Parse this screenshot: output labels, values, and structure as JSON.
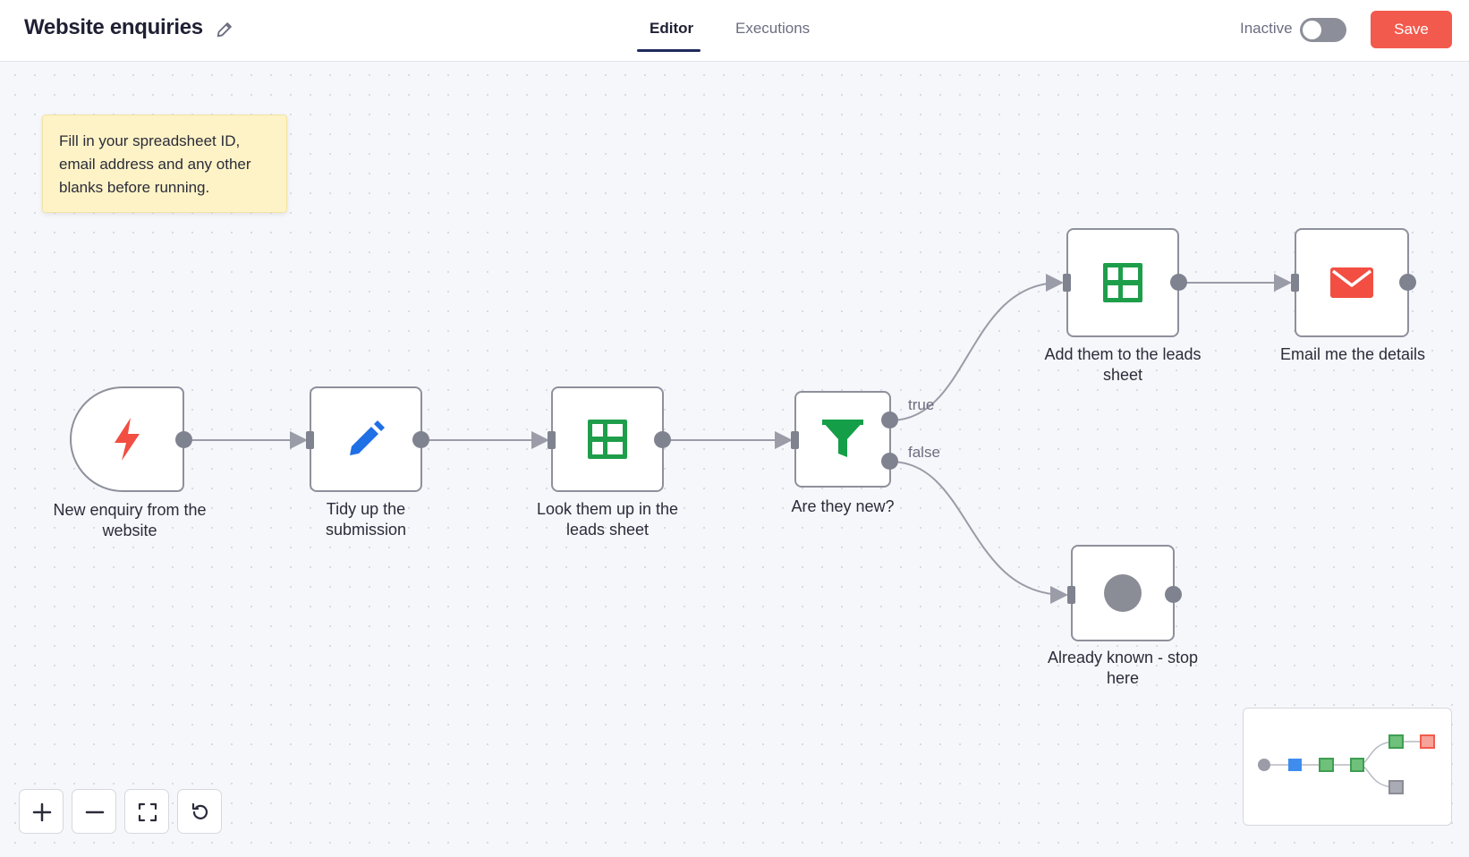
{
  "header": {
    "title": "Website enquiries",
    "tabs": [
      {
        "label": "Editor",
        "active": true
      },
      {
        "label": "Executions",
        "active": false
      }
    ],
    "status_label": "Inactive",
    "active": false,
    "save_label": "Save"
  },
  "sticky_note": {
    "text": "Fill in your spreadsheet ID, email address and any other blanks before running."
  },
  "nodes": [
    {
      "id": "trigger",
      "label": "New enquiry from the website",
      "icon": "lightning-icon",
      "icon_color": "#f24e42"
    },
    {
      "id": "set",
      "label": "Tidy up the submission",
      "icon": "pencil-icon",
      "icon_color": "#1f6fe5"
    },
    {
      "id": "lookup",
      "label": "Look them up in the leads sheet",
      "icon": "google-sheets-icon",
      "icon_color": "#1e9e4a"
    },
    {
      "id": "if",
      "label": "Are they new?",
      "icon": "filter-icon",
      "icon_color": "#149e47"
    },
    {
      "id": "append",
      "label": "Add them to the leads sheet",
      "icon": "google-sheets-icon",
      "icon_color": "#1e9e4a"
    },
    {
      "id": "email",
      "label": "Email me the details",
      "icon": "mail-icon",
      "icon_color": "#f24e42"
    },
    {
      "id": "noop",
      "label": "Already known - stop here",
      "icon": "no-op-icon",
      "icon_color": "#8a8c96"
    }
  ],
  "branches": {
    "true_label": "true",
    "false_label": "false"
  },
  "controls": [
    {
      "name": "zoom-in",
      "icon": "plus-icon"
    },
    {
      "name": "zoom-out",
      "icon": "minus-icon"
    },
    {
      "name": "fit-view",
      "icon": "fit-view-icon"
    },
    {
      "name": "reset-zoom",
      "icon": "reset-icon"
    }
  ],
  "colors": {
    "accent": "#f25a4d",
    "edge": "#9a9ca8",
    "sheets_green": "#1e9e4a",
    "trigger_red": "#f24e42"
  }
}
